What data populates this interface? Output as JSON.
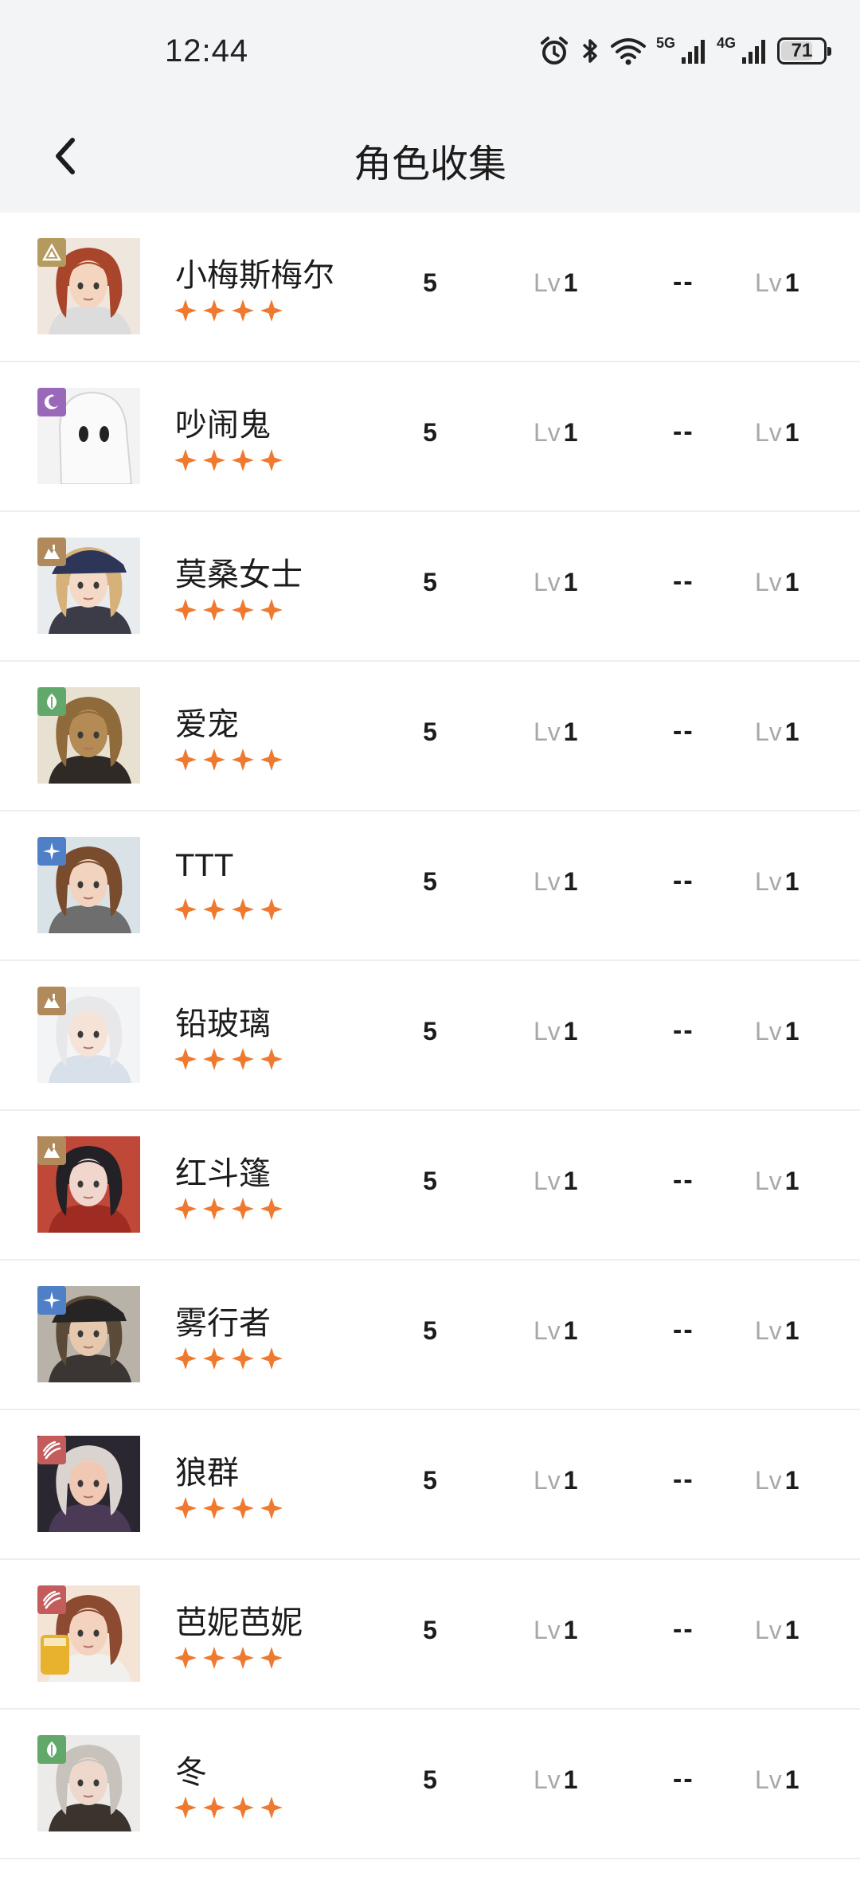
{
  "status_bar": {
    "time": "12:44",
    "net1": "5G",
    "net2": "4G",
    "battery_level": "71",
    "icons": [
      "alarm-icon",
      "bluetooth-icon",
      "wifi-icon",
      "signal-5g-icon",
      "signal-4g-icon",
      "battery-icon"
    ]
  },
  "header": {
    "title": "角色收集",
    "back_icon": "chevron-left-icon"
  },
  "colors": {
    "star": "#ef7a2f",
    "badge_yellow": "#b49a5e",
    "badge_purple": "#9a68b8",
    "badge_tan": "#b08a5a",
    "badge_green": "#62a86a",
    "badge_blue": "#4f7fc7",
    "badge_red": "#c45c5c"
  },
  "rows": [
    {
      "name": "小梅斯梅尔",
      "stars": 4,
      "value": "5",
      "lv_label_1": "Lv",
      "lv_value_1": "1",
      "placeholder": "--",
      "lv_label_2": "Lv",
      "lv_value_2": "1",
      "element_icon": "triangle-sigil-icon",
      "element_color": "#b49a5e",
      "portrait": "red-curly-hair-portrait"
    },
    {
      "name": "吵闹鬼",
      "stars": 4,
      "value": "5",
      "lv_label_1": "Lv",
      "lv_value_1": "1",
      "placeholder": "--",
      "lv_label_2": "Lv",
      "lv_value_2": "1",
      "element_icon": "moon-icon",
      "element_color": "#9a68b8",
      "portrait": "white-ghost-portrait"
    },
    {
      "name": "莫桑女士",
      "stars": 4,
      "value": "5",
      "lv_label_1": "Lv",
      "lv_value_1": "1",
      "placeholder": "--",
      "lv_label_2": "Lv",
      "lv_value_2": "1",
      "element_icon": "mountain-icon",
      "element_color": "#b08a5a",
      "portrait": "blonde-hat-lady-portrait"
    },
    {
      "name": "爱宠",
      "stars": 4,
      "value": "5",
      "lv_label_1": "Lv",
      "lv_value_1": "1",
      "placeholder": "--",
      "lv_label_2": "Lv",
      "lv_value_2": "1",
      "element_icon": "leaf-icon",
      "element_color": "#62a86a",
      "portrait": "scarecrow-portrait"
    },
    {
      "name": "TTT",
      "stars": 4,
      "value": "5",
      "lv_label_1": "Lv",
      "lv_value_1": "1",
      "placeholder": "--",
      "lv_label_2": "Lv",
      "lv_value_2": "1",
      "element_icon": "star-sparkle-icon",
      "element_color": "#4f7fc7",
      "portrait": "brown-hair-girl-portrait"
    },
    {
      "name": "铅玻璃",
      "stars": 4,
      "value": "5",
      "lv_label_1": "Lv",
      "lv_value_1": "1",
      "placeholder": "--",
      "lv_label_2": "Lv",
      "lv_value_2": "1",
      "element_icon": "mountain-icon",
      "element_color": "#b08a5a",
      "portrait": "white-hair-girl-portrait"
    },
    {
      "name": "红斗篷",
      "stars": 4,
      "value": "5",
      "lv_label_1": "Lv",
      "lv_value_1": "1",
      "placeholder": "--",
      "lv_label_2": "Lv",
      "lv_value_2": "1",
      "element_icon": "mountain-icon",
      "element_color": "#b08a5a",
      "portrait": "red-cloak-portrait"
    },
    {
      "name": "雾行者",
      "stars": 4,
      "value": "5",
      "lv_label_1": "Lv",
      "lv_value_1": "1",
      "placeholder": "--",
      "lv_label_2": "Lv",
      "lv_value_2": "1",
      "element_icon": "star-sparkle-icon",
      "element_color": "#4f7fc7",
      "portrait": "hat-gentleman-portrait"
    },
    {
      "name": "狼群",
      "stars": 4,
      "value": "5",
      "lv_label_1": "Lv",
      "lv_value_1": "1",
      "placeholder": "--",
      "lv_label_2": "Lv",
      "lv_value_2": "1",
      "element_icon": "claw-icon",
      "element_color": "#c45c5c",
      "portrait": "silver-hair-glasses-portrait"
    },
    {
      "name": "芭妮芭妮",
      "stars": 4,
      "value": "5",
      "lv_label_1": "Lv",
      "lv_value_1": "1",
      "placeholder": "--",
      "lv_label_2": "Lv",
      "lv_value_2": "1",
      "element_icon": "claw-icon",
      "element_color": "#c45c5c",
      "portrait": "auburn-hair-girl-portrait"
    },
    {
      "name": "冬",
      "stars": 4,
      "value": "5",
      "lv_label_1": "Lv",
      "lv_value_1": "1",
      "placeholder": "--",
      "lv_label_2": "Lv",
      "lv_value_2": "1",
      "element_icon": "leaf-icon",
      "element_color": "#62a86a",
      "portrait": "grey-hair-man-portrait"
    }
  ]
}
